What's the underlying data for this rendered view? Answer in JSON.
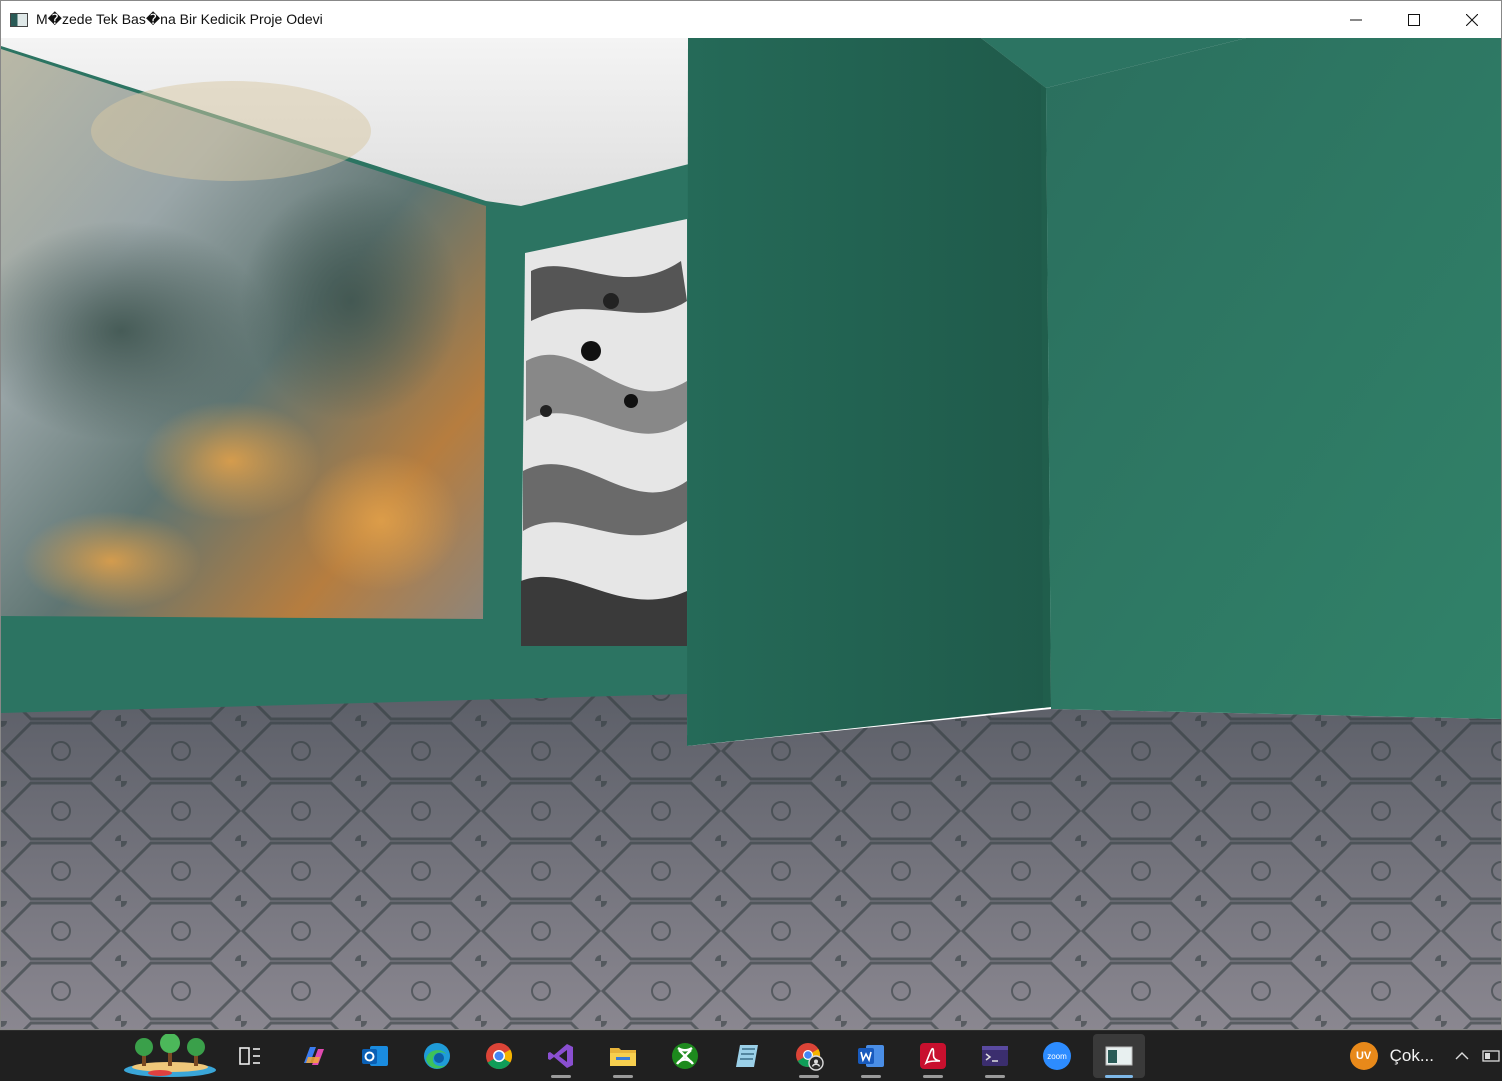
{
  "window": {
    "title": "M�zede Tek Bas�na Bir Kedicik Proje Odevi",
    "controls": [
      {
        "name": "minimize-button",
        "icon": "minimize-icon"
      },
      {
        "name": "maximize-button",
        "icon": "maximize-icon"
      },
      {
        "name": "close-button",
        "icon": "close-icon"
      }
    ]
  },
  "scene": {
    "wall_color": "#2c7462",
    "ceiling_color": "#e8e8e8",
    "floor_color": "#6a6a72",
    "paintings": [
      {
        "name": "landscape-painting",
        "style": "impressionist trees, blue-grey with orange"
      },
      {
        "name": "marble-painting",
        "style": "black and white ink marbling"
      }
    ]
  },
  "taskbar": {
    "apps": [
      {
        "name": "widgets-icon",
        "active": false,
        "indicator": false
      },
      {
        "name": "task-view-icon",
        "active": false,
        "indicator": false
      },
      {
        "name": "copilot-icon",
        "active": false,
        "indicator": false
      },
      {
        "name": "outlook-icon",
        "active": false,
        "indicator": false
      },
      {
        "name": "edge-icon",
        "active": false,
        "indicator": false
      },
      {
        "name": "chrome-icon",
        "active": false,
        "indicator": false
      },
      {
        "name": "visual-studio-icon",
        "active": false,
        "indicator": true
      },
      {
        "name": "file-explorer-icon",
        "active": false,
        "indicator": true
      },
      {
        "name": "xbox-icon",
        "active": false,
        "indicator": false
      },
      {
        "name": "notepad-icon",
        "active": false,
        "indicator": false
      },
      {
        "name": "chrome-profile-icon",
        "active": false,
        "indicator": true
      },
      {
        "name": "word-icon",
        "active": false,
        "indicator": true
      },
      {
        "name": "acrobat-icon",
        "active": false,
        "indicator": true
      },
      {
        "name": "terminal-icon",
        "active": false,
        "indicator": true
      },
      {
        "name": "zoom-icon",
        "active": false,
        "indicator": false
      },
      {
        "name": "museum-app-icon",
        "active": true,
        "indicator": true
      }
    ],
    "zoom_label": "zoom",
    "user_initials": "UV",
    "tray_label": "Çok...",
    "tray_chevron": "^"
  }
}
